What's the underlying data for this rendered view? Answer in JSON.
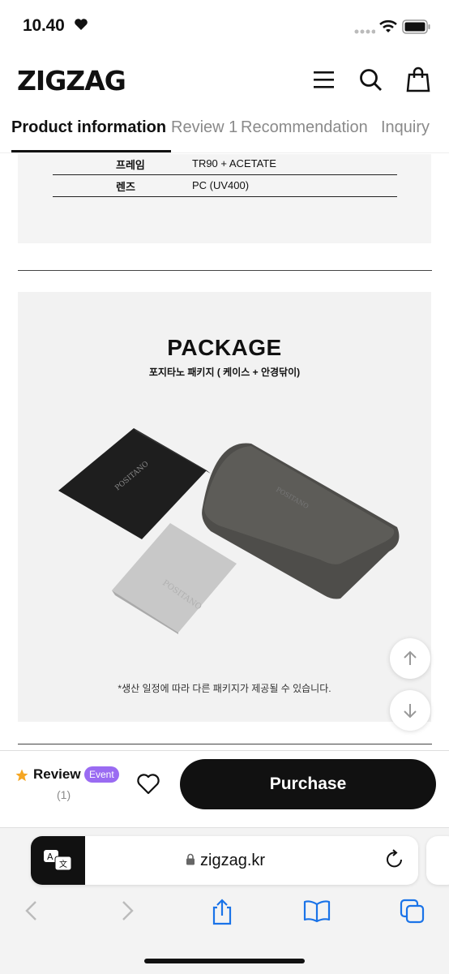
{
  "status_bar": {
    "time": "10.40"
  },
  "header": {
    "logo": "ZIGZAG"
  },
  "tabs": [
    {
      "label": "Product information",
      "active": true
    },
    {
      "label": "Review 1",
      "active": false
    },
    {
      "label": "Recommendation",
      "active": false
    },
    {
      "label": "Inquiry",
      "active": false
    }
  ],
  "spec_table": [
    {
      "key": "프레임",
      "value": "TR90 + ACETATE"
    },
    {
      "key": "렌즈",
      "value": "PC (UV400)"
    }
  ],
  "package": {
    "title": "PACKAGE",
    "subtitle": "포지타노 패키지 ( 케이스 + 안경닦이)",
    "note": "*생산 일정에 따라 다른 패키지가 제공될 수 있습니다.",
    "brand_mark": "POSITANO"
  },
  "bottom_bar": {
    "review_label": "Review",
    "event_badge": "Event",
    "review_count": "(1)",
    "purchase_label": "Purchase"
  },
  "browser": {
    "url": "zigzag.kr"
  },
  "colors": {
    "accent_event": "#9a6bf2",
    "star": "#f5a623",
    "primary_button": "#111111"
  },
  "icons": [
    "heart-icon",
    "signal-icon",
    "wifi-icon",
    "battery-icon",
    "menu-icon",
    "search-icon",
    "bag-icon",
    "star-icon",
    "wishlist-heart-icon",
    "arrow-up-icon",
    "arrow-down-icon",
    "translate-icon",
    "lock-icon",
    "reload-icon",
    "back-icon",
    "forward-icon",
    "share-icon",
    "bookmarks-icon",
    "tabs-icon"
  ]
}
